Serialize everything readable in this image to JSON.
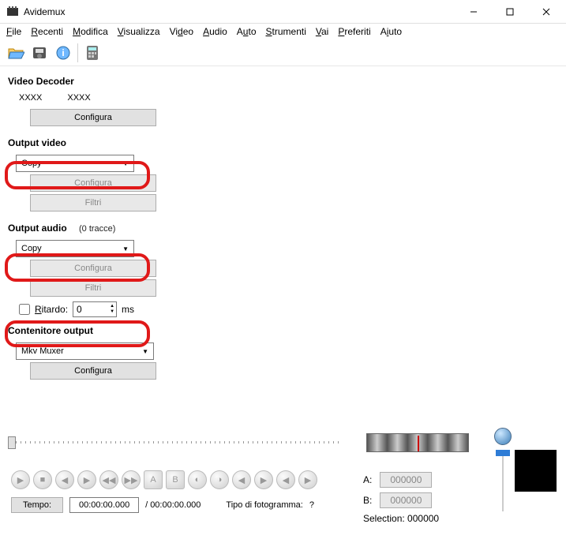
{
  "window": {
    "title": "Avidemux"
  },
  "menu": {
    "file": "File",
    "recenti": "Recenti",
    "modifica": "Modifica",
    "visualizza": "Visualizza",
    "video": "Video",
    "audio": "Audio",
    "auto": "Auto",
    "strumenti": "Strumenti",
    "vai": "Vai",
    "preferiti": "Preferiti",
    "aiuto": "Aiuto"
  },
  "decoder": {
    "title": "Video Decoder",
    "col1": "XXXX",
    "col2": "XXXX",
    "configure": "Configura"
  },
  "output_video": {
    "title": "Output video",
    "codec": "Copy",
    "configure": "Configura",
    "filters": "Filtri"
  },
  "output_audio": {
    "title": "Output audio",
    "tracks_note": "(0 tracce)",
    "codec": "Copy",
    "configure": "Configura",
    "filters": "Filtri",
    "shift_label": "Ritardo:",
    "shift_value": "0",
    "shift_unit": "ms"
  },
  "container": {
    "title": "Contenitore output",
    "muxer": "Mkv Muxer",
    "configure": "Configura"
  },
  "status": {
    "tempo_label": "Tempo:",
    "tempo_value": "00:00:00.000",
    "duration": "/ 00:00:00.000",
    "frametype_label": "Tipo di fotogramma:",
    "frametype_value": "?"
  },
  "markers": {
    "a_label": "A:",
    "a_value": "000000",
    "b_label": "B:",
    "b_value": "000000",
    "selection_label": "Selection:",
    "selection_value": "000000"
  }
}
